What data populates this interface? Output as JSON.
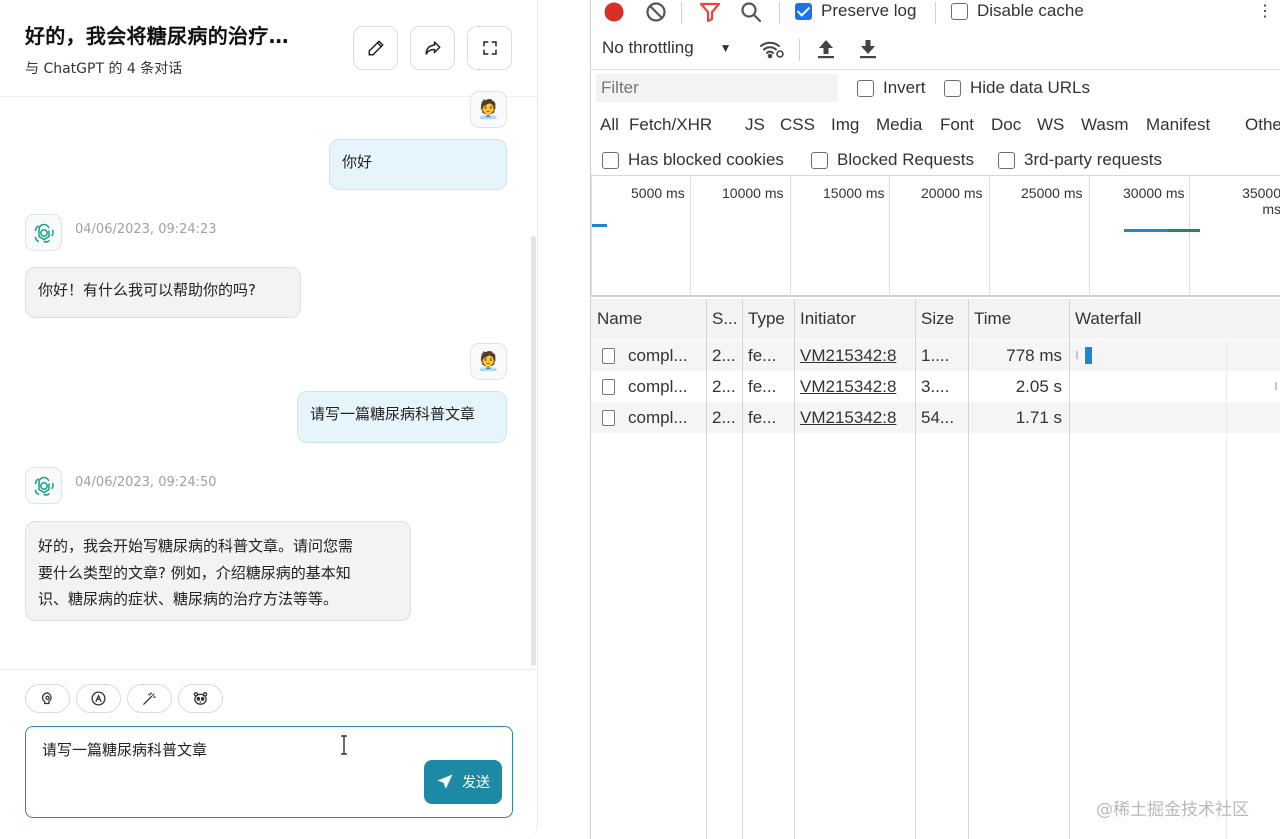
{
  "chat": {
    "title": "好的，我会将糖尿病的治疗…",
    "subtitle": "与 ChatGPT 的 4 条对话",
    "header_buttons": [
      {
        "name": "edit-button",
        "icon": "pencil-icon"
      },
      {
        "name": "share-button",
        "icon": "share-arrow-icon"
      },
      {
        "name": "fullscreen-button",
        "icon": "expand-icon"
      }
    ],
    "messages": [
      {
        "role": "user",
        "avatar": "🧑‍💼",
        "text": "你好"
      },
      {
        "role": "bot",
        "time": "04/06/2023, 09:24:23",
        "text": "你好！有什么我可以帮助你的吗?"
      },
      {
        "role": "user",
        "avatar": "🧑‍💼",
        "text": "请写一篇糖尿病科普文章"
      },
      {
        "role": "bot",
        "time": "04/06/2023, 09:24:50",
        "lines": [
          "好的，我会开始写糖尿病的科普文章。请问您需",
          "要什么类型的文章? 例如，介绍糖尿病的基本知",
          "识、糖尿病的症状、糖尿病的治疗方法等等。"
        ]
      }
    ],
    "tool_buttons": [
      "brain-icon",
      "text-a-icon",
      "magic-wand-icon",
      "panda-icon"
    ],
    "input_value": "请写一篇糖尿病科普文章",
    "send_label": "发送"
  },
  "devtools": {
    "toolbar": {
      "preserve_log": {
        "label": "Preserve log",
        "checked": true
      },
      "disable_cache": {
        "label": "Disable cache",
        "checked": false
      },
      "throttling": "No throttling"
    },
    "filter_placeholder": "Filter",
    "invert_label": "Invert",
    "hide_data_urls_label": "Hide data URLs",
    "type_tabs": [
      "All",
      "Fetch/XHR",
      "JS",
      "CSS",
      "Img",
      "Media",
      "Font",
      "Doc",
      "WS",
      "Wasm",
      "Manifest",
      "Other"
    ],
    "active_tab": "Fetch/XHR",
    "blocked_filters": [
      "Has blocked cookies",
      "Blocked Requests",
      "3rd-party requests"
    ],
    "overview_ticks": [
      "5000 ms",
      "10000 ms",
      "15000 ms",
      "20000 ms",
      "25000 ms",
      "30000 ms",
      "35000 ms"
    ],
    "columns": [
      "Name",
      "S...",
      "Type",
      "Initiator",
      "Size",
      "Time",
      "Waterfall"
    ],
    "rows": [
      {
        "name": "compl...",
        "status": "2...",
        "type": "fe...",
        "initiator": "VM215342:8",
        "size": "1....",
        "time": "778 ms"
      },
      {
        "name": "compl...",
        "status": "2...",
        "type": "fe...",
        "initiator": "VM215342:8",
        "size": "3....",
        "time": "2.05 s"
      },
      {
        "name": "compl...",
        "status": "2...",
        "type": "fe...",
        "initiator": "VM215342:8",
        "size": "54...",
        "time": "1.71 s"
      }
    ],
    "colors": {
      "record": "#d93025",
      "filter_active": "#e8453c",
      "check_on": "#1a73e8",
      "bar_blue": "#1a87d0",
      "bar_green": "#1e8a5c"
    }
  },
  "watermark": "@稀土掘金技术社区"
}
